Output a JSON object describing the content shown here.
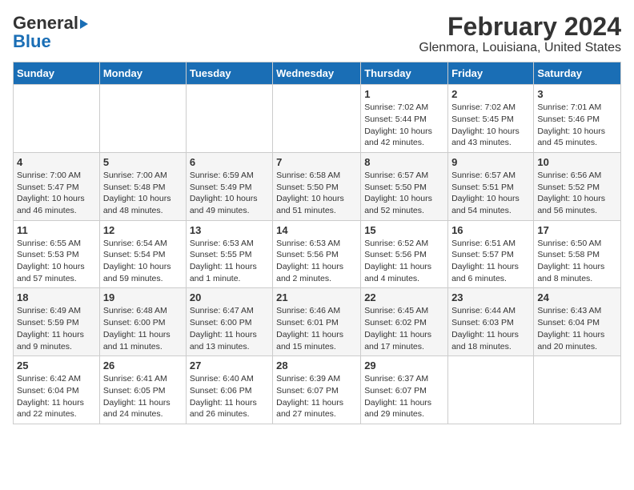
{
  "header": {
    "logo_line1": "General",
    "logo_line2": "Blue",
    "title": "February 2024",
    "subtitle": "Glenmora, Louisiana, United States"
  },
  "days_of_week": [
    "Sunday",
    "Monday",
    "Tuesday",
    "Wednesday",
    "Thursday",
    "Friday",
    "Saturday"
  ],
  "weeks": [
    [
      {
        "day": "",
        "info": ""
      },
      {
        "day": "",
        "info": ""
      },
      {
        "day": "",
        "info": ""
      },
      {
        "day": "",
        "info": ""
      },
      {
        "day": "1",
        "info": "Sunrise: 7:02 AM\nSunset: 5:44 PM\nDaylight: 10 hours\nand 42 minutes."
      },
      {
        "day": "2",
        "info": "Sunrise: 7:02 AM\nSunset: 5:45 PM\nDaylight: 10 hours\nand 43 minutes."
      },
      {
        "day": "3",
        "info": "Sunrise: 7:01 AM\nSunset: 5:46 PM\nDaylight: 10 hours\nand 45 minutes."
      }
    ],
    [
      {
        "day": "4",
        "info": "Sunrise: 7:00 AM\nSunset: 5:47 PM\nDaylight: 10 hours\nand 46 minutes."
      },
      {
        "day": "5",
        "info": "Sunrise: 7:00 AM\nSunset: 5:48 PM\nDaylight: 10 hours\nand 48 minutes."
      },
      {
        "day": "6",
        "info": "Sunrise: 6:59 AM\nSunset: 5:49 PM\nDaylight: 10 hours\nand 49 minutes."
      },
      {
        "day": "7",
        "info": "Sunrise: 6:58 AM\nSunset: 5:50 PM\nDaylight: 10 hours\nand 51 minutes."
      },
      {
        "day": "8",
        "info": "Sunrise: 6:57 AM\nSunset: 5:50 PM\nDaylight: 10 hours\nand 52 minutes."
      },
      {
        "day": "9",
        "info": "Sunrise: 6:57 AM\nSunset: 5:51 PM\nDaylight: 10 hours\nand 54 minutes."
      },
      {
        "day": "10",
        "info": "Sunrise: 6:56 AM\nSunset: 5:52 PM\nDaylight: 10 hours\nand 56 minutes."
      }
    ],
    [
      {
        "day": "11",
        "info": "Sunrise: 6:55 AM\nSunset: 5:53 PM\nDaylight: 10 hours\nand 57 minutes."
      },
      {
        "day": "12",
        "info": "Sunrise: 6:54 AM\nSunset: 5:54 PM\nDaylight: 10 hours\nand 59 minutes."
      },
      {
        "day": "13",
        "info": "Sunrise: 6:53 AM\nSunset: 5:55 PM\nDaylight: 11 hours\nand 1 minute."
      },
      {
        "day": "14",
        "info": "Sunrise: 6:53 AM\nSunset: 5:56 PM\nDaylight: 11 hours\nand 2 minutes."
      },
      {
        "day": "15",
        "info": "Sunrise: 6:52 AM\nSunset: 5:56 PM\nDaylight: 11 hours\nand 4 minutes."
      },
      {
        "day": "16",
        "info": "Sunrise: 6:51 AM\nSunset: 5:57 PM\nDaylight: 11 hours\nand 6 minutes."
      },
      {
        "day": "17",
        "info": "Sunrise: 6:50 AM\nSunset: 5:58 PM\nDaylight: 11 hours\nand 8 minutes."
      }
    ],
    [
      {
        "day": "18",
        "info": "Sunrise: 6:49 AM\nSunset: 5:59 PM\nDaylight: 11 hours\nand 9 minutes."
      },
      {
        "day": "19",
        "info": "Sunrise: 6:48 AM\nSunset: 6:00 PM\nDaylight: 11 hours\nand 11 minutes."
      },
      {
        "day": "20",
        "info": "Sunrise: 6:47 AM\nSunset: 6:00 PM\nDaylight: 11 hours\nand 13 minutes."
      },
      {
        "day": "21",
        "info": "Sunrise: 6:46 AM\nSunset: 6:01 PM\nDaylight: 11 hours\nand 15 minutes."
      },
      {
        "day": "22",
        "info": "Sunrise: 6:45 AM\nSunset: 6:02 PM\nDaylight: 11 hours\nand 17 minutes."
      },
      {
        "day": "23",
        "info": "Sunrise: 6:44 AM\nSunset: 6:03 PM\nDaylight: 11 hours\nand 18 minutes."
      },
      {
        "day": "24",
        "info": "Sunrise: 6:43 AM\nSunset: 6:04 PM\nDaylight: 11 hours\nand 20 minutes."
      }
    ],
    [
      {
        "day": "25",
        "info": "Sunrise: 6:42 AM\nSunset: 6:04 PM\nDaylight: 11 hours\nand 22 minutes."
      },
      {
        "day": "26",
        "info": "Sunrise: 6:41 AM\nSunset: 6:05 PM\nDaylight: 11 hours\nand 24 minutes."
      },
      {
        "day": "27",
        "info": "Sunrise: 6:40 AM\nSunset: 6:06 PM\nDaylight: 11 hours\nand 26 minutes."
      },
      {
        "day": "28",
        "info": "Sunrise: 6:39 AM\nSunset: 6:07 PM\nDaylight: 11 hours\nand 27 minutes."
      },
      {
        "day": "29",
        "info": "Sunrise: 6:37 AM\nSunset: 6:07 PM\nDaylight: 11 hours\nand 29 minutes."
      },
      {
        "day": "",
        "info": ""
      },
      {
        "day": "",
        "info": ""
      }
    ]
  ]
}
